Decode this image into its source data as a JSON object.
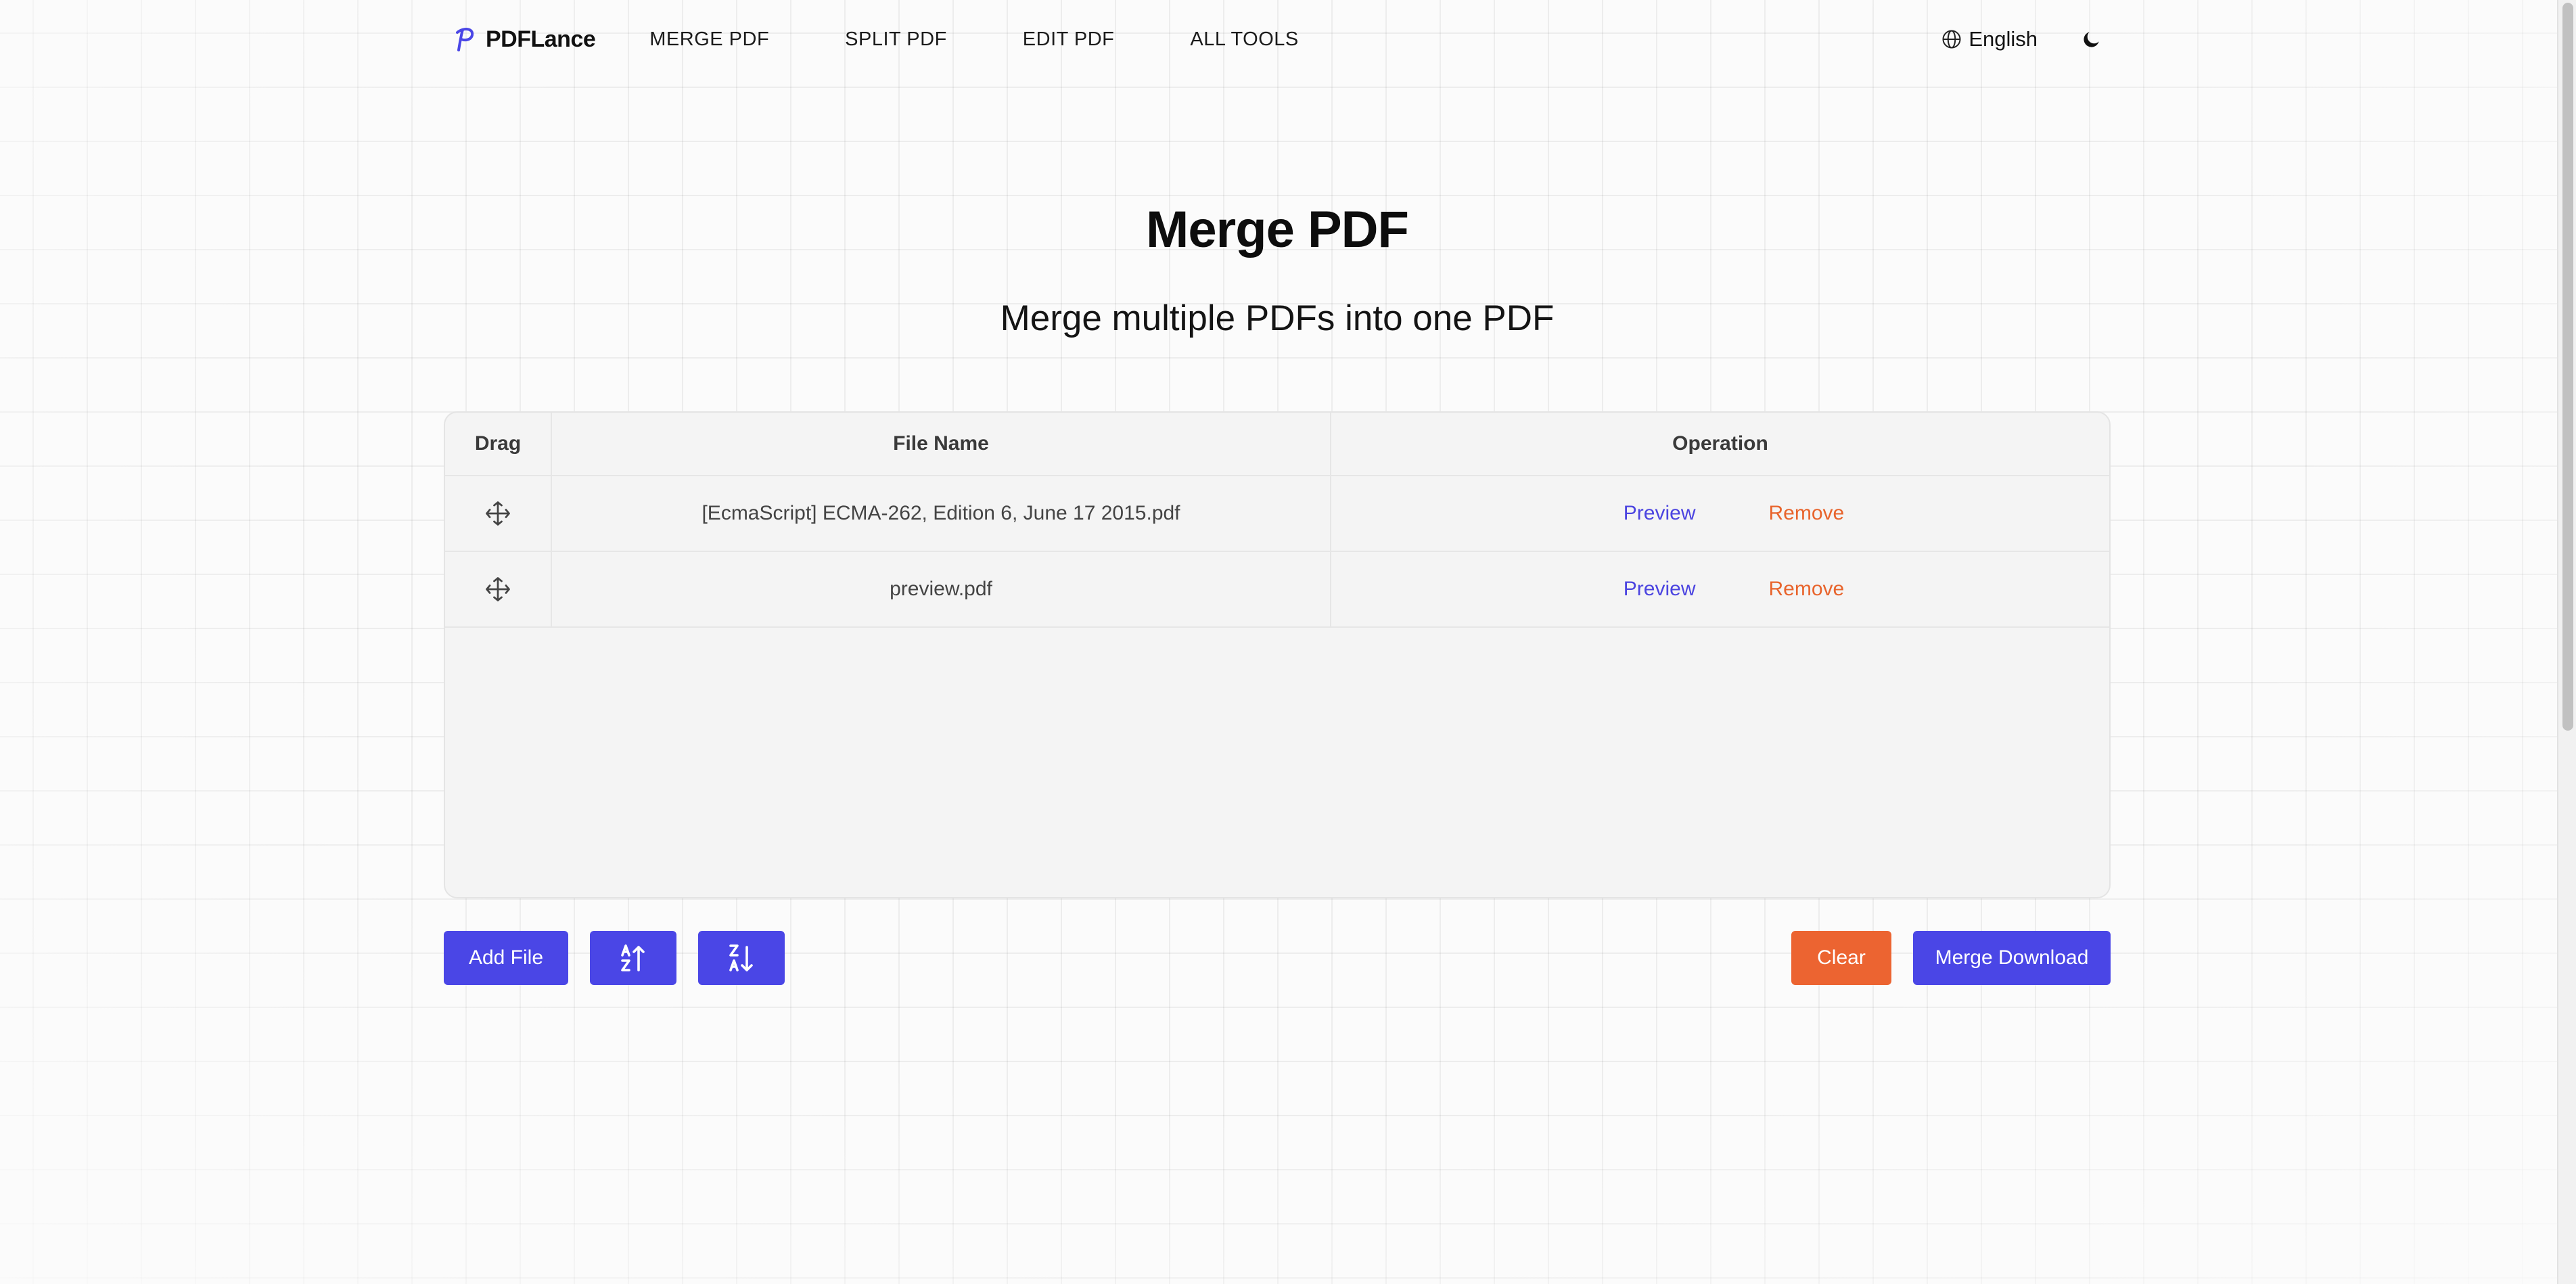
{
  "header": {
    "logo_text": "PDFLance",
    "nav": [
      "MERGE PDF",
      "SPLIT PDF",
      "EDIT PDF",
      "ALL TOOLS"
    ],
    "language": "English"
  },
  "main": {
    "title": "Merge PDF",
    "subtitle": "Merge multiple PDFs into one PDF"
  },
  "table": {
    "columns": [
      "Drag",
      "File Name",
      "Operation"
    ],
    "rows": [
      {
        "file_name": "[EcmaScript] ECMA-262, Edition 6, June 17 2015.pdf",
        "preview": "Preview",
        "remove": "Remove"
      },
      {
        "file_name": "preview.pdf",
        "preview": "Preview",
        "remove": "Remove"
      }
    ]
  },
  "actions": {
    "add_file": "Add File",
    "clear": "Clear",
    "merge_download": "Merge Download"
  },
  "colors": {
    "accent": "#4a46e6",
    "danger": "#ec6431"
  },
  "icons": {
    "drag": "move-icon",
    "sort_asc": "sort-a-z-icon",
    "sort_desc": "sort-z-a-icon",
    "language": "globe-icon",
    "theme": "moon-icon"
  }
}
